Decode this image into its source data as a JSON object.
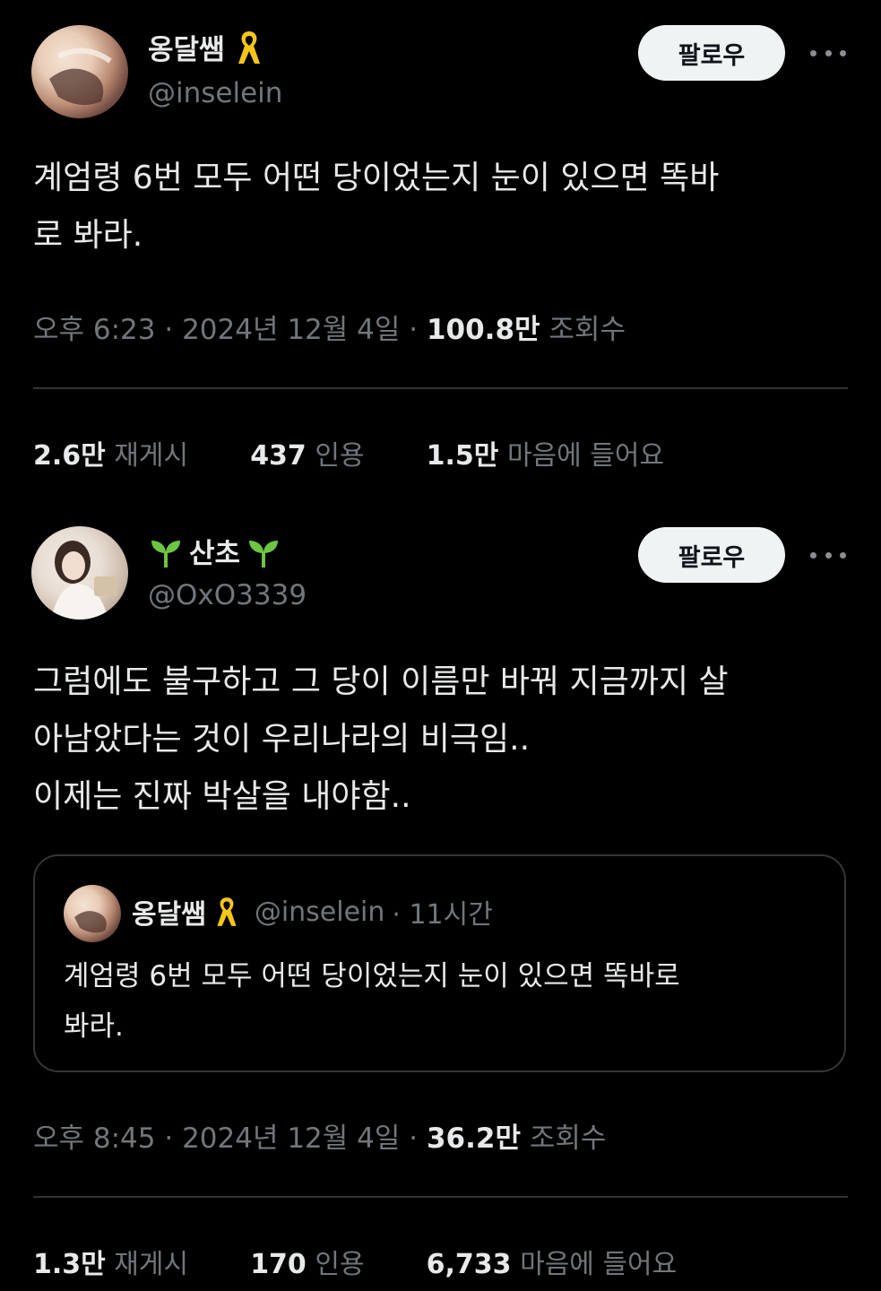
{
  "tweet1": {
    "display_name": "옹달쌤",
    "handle": "@inselein",
    "follow_label": "팔로우",
    "text": "계엄령 6번 모두 어떤 당이었는지 눈이 있으면 똑바\n로 봐라.",
    "time": "오후 6:23 · 2024년 12월 4일 · ",
    "views": "100.8만",
    "views_label": " 조회수",
    "reposts": "2.6만",
    "reposts_label": " 재게시",
    "quotes": "437",
    "quotes_label": " 인용",
    "likes": "1.5만",
    "likes_label": " 마음에 들어요"
  },
  "tweet2": {
    "display_name": "산초",
    "handle": "@OxO3339",
    "follow_label": "팔로우",
    "text": "그럼에도 불구하고 그 당이 이름만 바꿔 지금까지 살\n아남았다는 것이 우리나라의 비극임..\n이제는 진짜 박살을 내야함..",
    "time": "오후 8:45 · 2024년 12월 4일 · ",
    "views": "36.2만",
    "views_label": " 조회수",
    "reposts": "1.3만",
    "reposts_label": " 재게시",
    "quotes": "170",
    "quotes_label": " 인용",
    "likes": "6,733",
    "likes_label": " 마음에 들어요"
  },
  "quoted": {
    "display_name": "옹달쌤",
    "handle": "@inselein",
    "age": " · 11시간",
    "text": "계엄령 6번 모두 어떤 당이었는지 눈이 있으면 똑바로\n봐라."
  },
  "colors": {
    "background": "#000000",
    "text": "#e7e9ea",
    "muted": "#71767b",
    "ribbon": "#f5c518",
    "sprout": "#6cc644"
  },
  "icons": [
    "yellow-ribbon-icon",
    "sprout-icon",
    "more-options-icon"
  ]
}
